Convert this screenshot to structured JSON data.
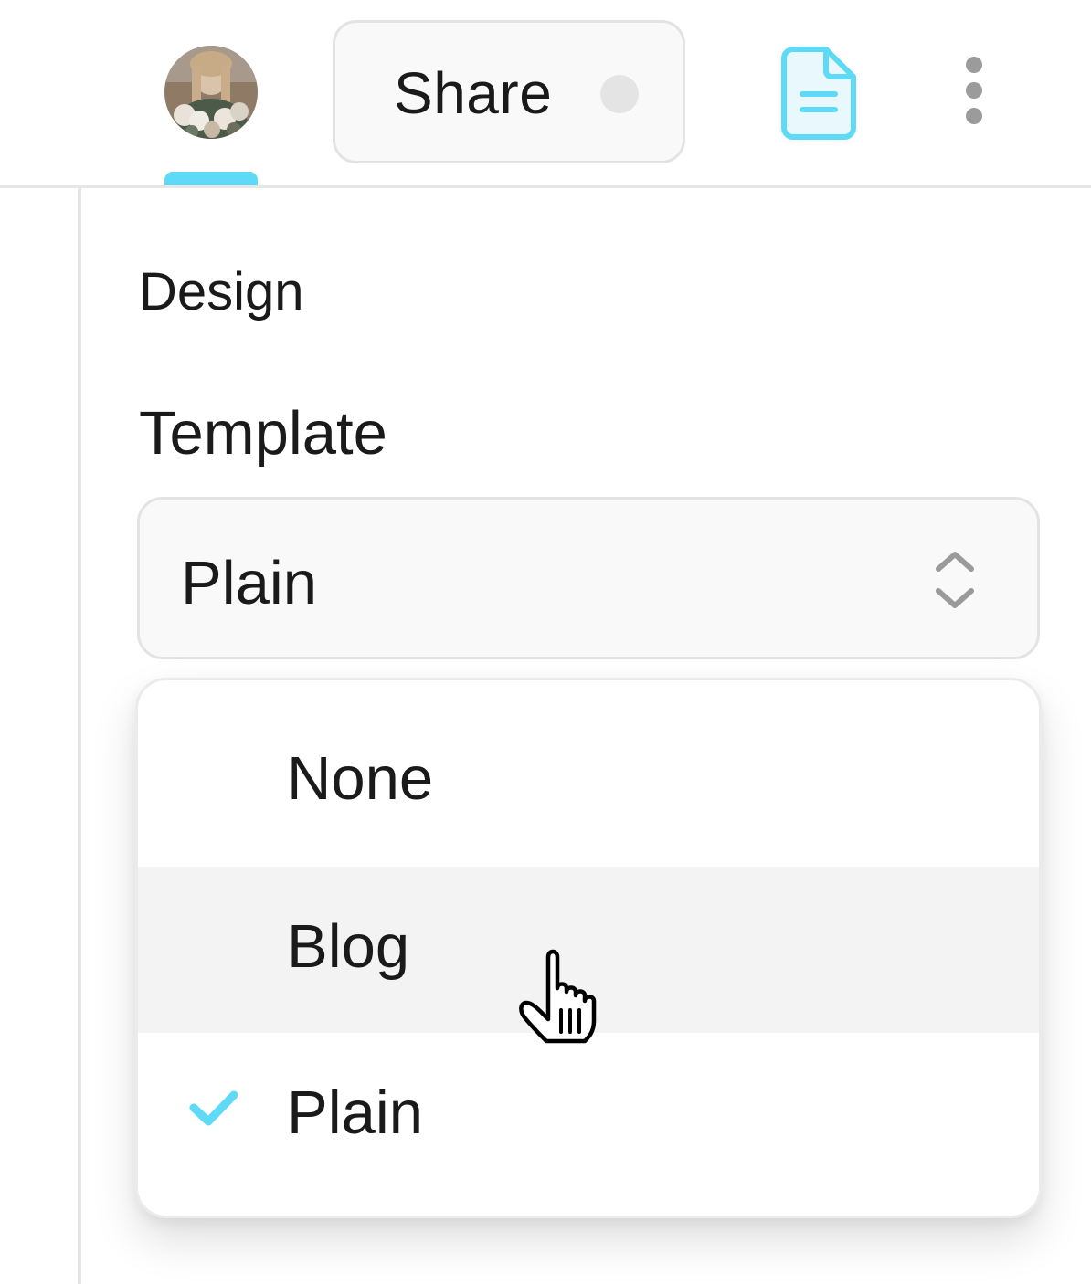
{
  "topbar": {
    "avatar_alt": "User avatar",
    "share_label": "Share",
    "accent_color": "#5fdaf6",
    "icons": [
      "document-icon",
      "more-vertical-icon",
      "status-dot"
    ]
  },
  "panel": {
    "section_title": "Design",
    "template_label": "Template",
    "template_select": {
      "value": "Plain",
      "icon": "chevron-up-down-icon"
    },
    "menu": {
      "options": [
        {
          "label": "None",
          "selected": false,
          "hovered": false
        },
        {
          "label": "Blog",
          "selected": false,
          "hovered": true
        },
        {
          "label": "Plain",
          "selected": true,
          "hovered": false
        }
      ],
      "check_icon": "checkmark-icon"
    }
  },
  "cursor": "pointer-hand-icon"
}
